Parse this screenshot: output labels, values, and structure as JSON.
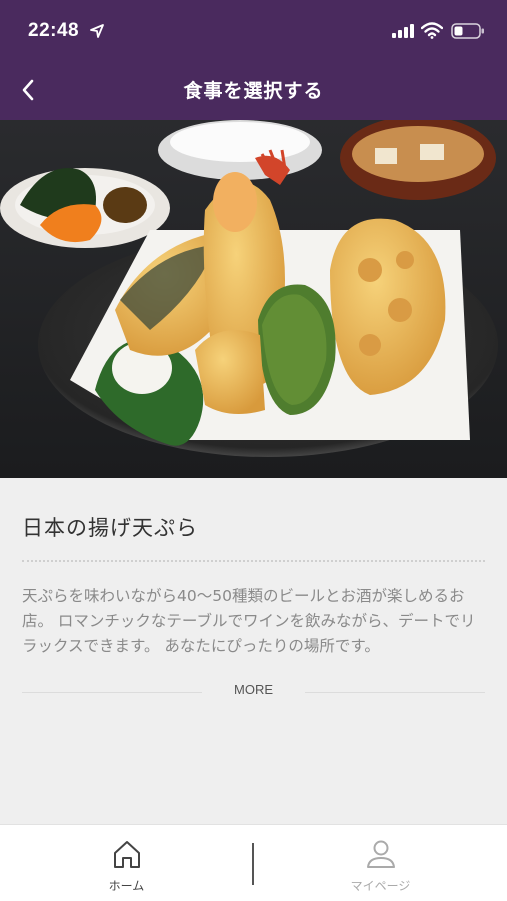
{
  "status_bar": {
    "time": "22:48"
  },
  "nav": {
    "title": "食事を選択する"
  },
  "dish": {
    "title": "日本の揚げ天ぷら",
    "description": "天ぷらを味わいながら40～50種類のビールとお酒が楽しめるお店。 ロマンチックなテーブルでワインを飲みながら、デートでリラックスできます。 あなたにぴったりの場所です。",
    "more_label": "MORE"
  },
  "tabs": [
    {
      "label": "ホーム",
      "icon": "home-icon",
      "active": true
    },
    {
      "label": "マイページ",
      "icon": "user-icon",
      "active": false
    }
  ],
  "colors": {
    "header": "#4a2a5e",
    "background": "#efefef",
    "title_text": "#333333",
    "body_text": "#8a8a8a"
  }
}
